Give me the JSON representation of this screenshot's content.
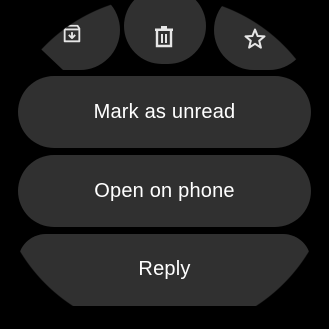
{
  "actions": {
    "top_icons": [
      {
        "name": "archive-icon"
      },
      {
        "name": "delete-icon"
      },
      {
        "name": "star-icon"
      }
    ],
    "mark_unread_label": "Mark as unread",
    "open_on_phone_label": "Open on phone",
    "reply_label": "Reply"
  },
  "colors": {
    "background": "#000000",
    "chip": "#303030",
    "text": "#ffffff",
    "icon": "#e6e6e6"
  }
}
